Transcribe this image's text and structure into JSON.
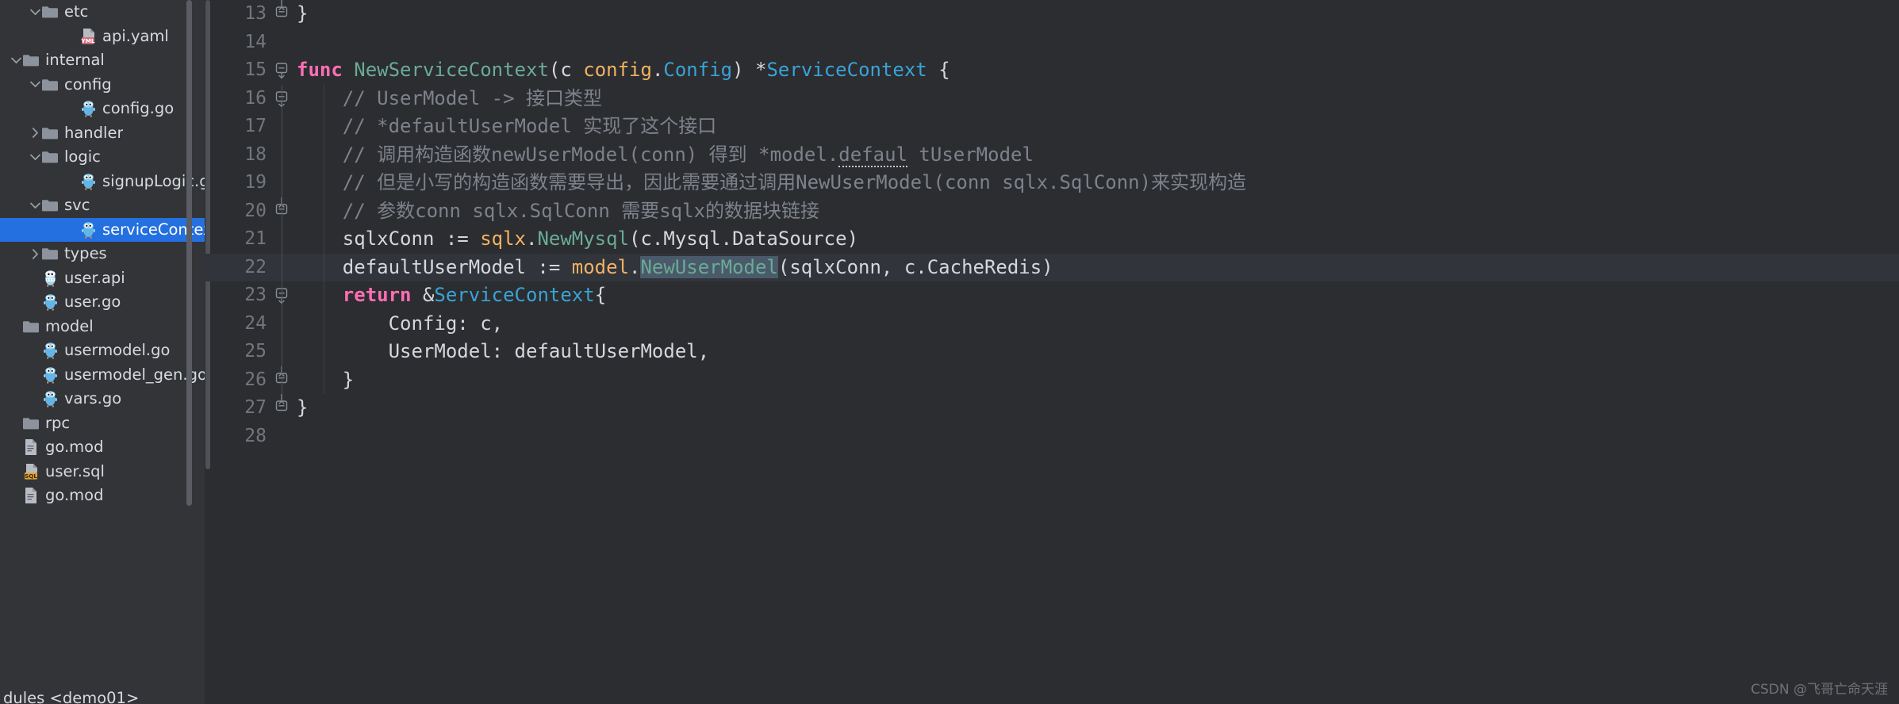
{
  "sidebar": {
    "name": "project-tree",
    "scrollbar_visible": true,
    "bottom_status": "dules <demo01>",
    "items": [
      {
        "label": "etc",
        "indent": 1,
        "arrow": "down",
        "icon": "folder-icon",
        "selected": false
      },
      {
        "label": "api.yaml",
        "indent": 3,
        "arrow": "none",
        "icon": "yaml-file-icon",
        "selected": false
      },
      {
        "label": "internal",
        "indent": 0,
        "arrow": "down",
        "icon": "folder-icon",
        "selected": false
      },
      {
        "label": "config",
        "indent": 1,
        "arrow": "down",
        "icon": "folder-icon",
        "selected": false
      },
      {
        "label": "config.go",
        "indent": 3,
        "arrow": "none",
        "icon": "go-file-icon",
        "selected": false
      },
      {
        "label": "handler",
        "indent": 1,
        "arrow": "right",
        "icon": "folder-icon",
        "selected": false
      },
      {
        "label": "logic",
        "indent": 1,
        "arrow": "down",
        "icon": "folder-icon",
        "selected": false
      },
      {
        "label": "signupLogic.go",
        "indent": 3,
        "arrow": "none",
        "icon": "go-file-icon",
        "selected": false
      },
      {
        "label": "svc",
        "indent": 1,
        "arrow": "down",
        "icon": "folder-icon",
        "selected": false
      },
      {
        "label": "serviceContext.go",
        "indent": 3,
        "arrow": "none",
        "icon": "go-file-icon",
        "selected": true
      },
      {
        "label": "types",
        "indent": 1,
        "arrow": "right",
        "icon": "folder-icon",
        "selected": false
      },
      {
        "label": "user.api",
        "indent": 1,
        "arrow": "none",
        "icon": "api-file-icon",
        "selected": false
      },
      {
        "label": "user.go",
        "indent": 1,
        "arrow": "none",
        "icon": "go-file-icon",
        "selected": false
      },
      {
        "label": "model",
        "indent": 0,
        "arrow": "none",
        "icon": "folder-icon",
        "selected": false
      },
      {
        "label": "usermodel.go",
        "indent": 1,
        "arrow": "none",
        "icon": "go-file-icon",
        "selected": false
      },
      {
        "label": "usermodel_gen.go",
        "indent": 1,
        "arrow": "none",
        "icon": "go-file-icon",
        "selected": false
      },
      {
        "label": "vars.go",
        "indent": 1,
        "arrow": "none",
        "icon": "go-file-icon",
        "selected": false
      },
      {
        "label": "rpc",
        "indent": 0,
        "arrow": "none",
        "icon": "folder-icon",
        "selected": false
      },
      {
        "label": "go.mod",
        "indent": 0,
        "arrow": "none",
        "icon": "text-file-icon",
        "selected": false
      },
      {
        "label": "user.sql",
        "indent": 0,
        "arrow": "none",
        "icon": "sql-file-icon",
        "selected": false
      },
      {
        "label": "go.mod",
        "indent": -1,
        "arrow": "none",
        "icon": "text-file-icon",
        "selected": false
      }
    ]
  },
  "editor": {
    "name": "code-editor",
    "language": "go",
    "current_line": 22,
    "first_visible_line": 13,
    "lines": [
      {
        "num": "13",
        "fold": "end",
        "guide": false,
        "indent": 0,
        "tokens": [
          {
            "t": "}",
            "c": "plain"
          }
        ]
      },
      {
        "num": "14",
        "fold": "none",
        "guide": false,
        "indent": 0,
        "tokens": []
      },
      {
        "num": "15",
        "fold": "start",
        "guide": false,
        "indent": 0,
        "tokens": [
          {
            "t": "func ",
            "c": "kw"
          },
          {
            "t": "NewServiceContext",
            "c": "func"
          },
          {
            "t": "(",
            "c": "plain"
          },
          {
            "t": "c ",
            "c": "plain"
          },
          {
            "t": "config",
            "c": "pkg"
          },
          {
            "t": ".",
            "c": "plain"
          },
          {
            "t": "Config",
            "c": "type"
          },
          {
            "t": ") *",
            "c": "plain"
          },
          {
            "t": "ServiceContext",
            "c": "type"
          },
          {
            "t": " {",
            "c": "plain"
          }
        ]
      },
      {
        "num": "16",
        "fold": "start",
        "guide": true,
        "indent": 1,
        "tokens": [
          {
            "t": "// UserModel -> 接口类型",
            "c": "com"
          }
        ]
      },
      {
        "num": "17",
        "fold": "none",
        "guide": true,
        "indent": 1,
        "tokens": [
          {
            "t": "// *defaultUserModel 实现了这个接口",
            "c": "com"
          }
        ]
      },
      {
        "num": "18",
        "fold": "none",
        "guide": true,
        "indent": 1,
        "tokens": [
          {
            "t": "// 调用构造函数newUserModel(conn) 得到 *model.",
            "c": "com"
          },
          {
            "t": "defaul",
            "c": "com-err"
          },
          {
            "t": " tUserModel",
            "c": "com"
          }
        ]
      },
      {
        "num": "19",
        "fold": "none",
        "guide": true,
        "indent": 1,
        "tokens": [
          {
            "t": "// 但是小写的构造函数需要导出，因此需要通过调用NewUserModel(conn sqlx.SqlConn)来实现构造",
            "c": "com"
          }
        ]
      },
      {
        "num": "20",
        "fold": "end",
        "guide": true,
        "indent": 1,
        "tokens": [
          {
            "t": "// 参数conn sqlx.SqlConn 需要sqlx的数据块链接",
            "c": "com"
          }
        ]
      },
      {
        "num": "21",
        "fold": "none",
        "guide": true,
        "indent": 1,
        "tokens": [
          {
            "t": "sqlxConn := ",
            "c": "plain"
          },
          {
            "t": "sqlx",
            "c": "pkg"
          },
          {
            "t": ".",
            "c": "plain"
          },
          {
            "t": "NewMysql",
            "c": "func"
          },
          {
            "t": "(c.Mysql.DataSource)",
            "c": "plain"
          }
        ]
      },
      {
        "num": "22",
        "fold": "none",
        "guide": true,
        "indent": 1,
        "current": true,
        "tokens": [
          {
            "t": "defaultUserModel := ",
            "c": "plain"
          },
          {
            "t": "model",
            "c": "pkg"
          },
          {
            "t": ".",
            "c": "plain"
          },
          {
            "t": "NewUserModel",
            "c": "sel"
          },
          {
            "t": "(sqlxConn, c.CacheRedis)",
            "c": "plain"
          }
        ]
      },
      {
        "num": "23",
        "fold": "start",
        "guide": true,
        "indent": 1,
        "tokens": [
          {
            "t": "return ",
            "c": "kw"
          },
          {
            "t": "&",
            "c": "plain"
          },
          {
            "t": "ServiceContext",
            "c": "type"
          },
          {
            "t": "{",
            "c": "plain"
          }
        ]
      },
      {
        "num": "24",
        "fold": "none",
        "guide": true,
        "indent": 2,
        "tokens": [
          {
            "t": "Config: c,",
            "c": "plain"
          }
        ]
      },
      {
        "num": "25",
        "fold": "none",
        "guide": true,
        "indent": 2,
        "tokens": [
          {
            "t": "UserModel: defaultUserModel,",
            "c": "plain"
          }
        ]
      },
      {
        "num": "26",
        "fold": "end",
        "guide": true,
        "indent": 1,
        "tokens": [
          {
            "t": "}",
            "c": "plain"
          }
        ]
      },
      {
        "num": "27",
        "fold": "end",
        "guide": false,
        "indent": 0,
        "tokens": [
          {
            "t": "}",
            "c": "plain"
          }
        ]
      },
      {
        "num": "28",
        "fold": "none",
        "guide": false,
        "indent": 0,
        "tokens": []
      }
    ]
  },
  "watermark": {
    "text": "CSDN @飞哥亡命天涯"
  },
  "colors": {
    "selection_blue": "#2470e0",
    "editor_bg": "#2b2d30",
    "sidebar_bg": "#323438",
    "current_line_bg": "#31343b",
    "keyword": "#ff6eb4",
    "function": "#6aab94",
    "package": "#f2b263",
    "type": "#3aa3d8",
    "comment": "#7d828c",
    "text": "#d4d7dd",
    "linenum": "#72767d",
    "sel_token_bg": "#4a5a6b"
  }
}
